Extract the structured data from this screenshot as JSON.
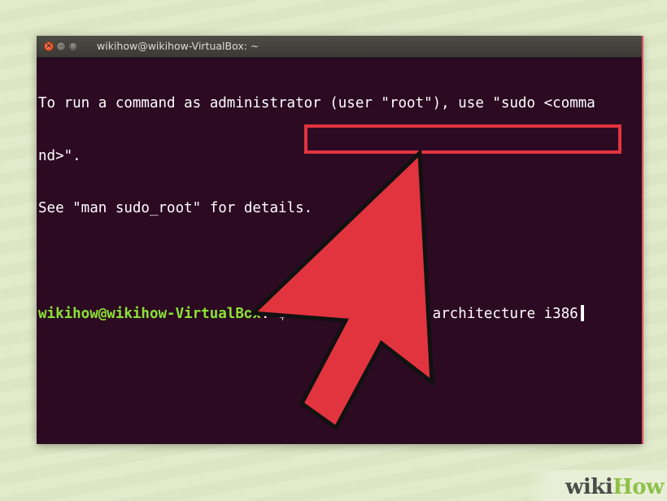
{
  "window": {
    "title": "wikihow@wikihow-VirtualBox: ~",
    "controls": [
      "close-icon",
      "minimize-icon",
      "maximize-icon"
    ],
    "control_glyphs": {
      "close": "×",
      "minimize": "–",
      "maximize": "□"
    }
  },
  "terminal": {
    "lines": [
      "To run a command as administrator (user \"root\"), use \"sudo <comma",
      "nd>\".",
      "See \"man sudo_root\" for details.",
      ""
    ],
    "prompt": {
      "user_host": "wikihow@wikihow-VirtualBox",
      "colon": ":",
      "path": "~",
      "symbol": "$ "
    },
    "command": "sudo dpkg --add-architecture i386"
  },
  "annotation": {
    "arrow": "pointer-arrow",
    "highlight_color": "#e2343f"
  },
  "logo": {
    "wiki": "wiki",
    "how": "How"
  },
  "colors": {
    "terminal_bg": "#2c0a22",
    "prompt_user": "#8ae234",
    "prompt_path": "#729fcf",
    "arrow_fill": "#e2343f",
    "logo_green": "#8fc04b"
  }
}
